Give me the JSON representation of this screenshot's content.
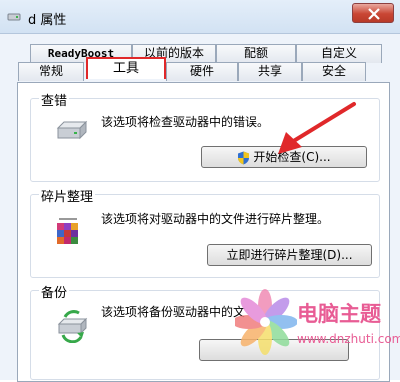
{
  "window": {
    "title": "d 属性"
  },
  "tabs_row1": [
    "ReadyBoost",
    "以前的版本",
    "配额",
    "自定义"
  ],
  "tabs_row2": [
    "常规",
    "工具",
    "硬件",
    "共享",
    "安全"
  ],
  "active_tab": "工具",
  "groups": [
    {
      "title": "查错",
      "desc": "该选项将检查驱动器中的错误。",
      "button": "开始检查(C)...",
      "icon": "hard-drive-icon"
    },
    {
      "title": "碎片整理",
      "desc": "该选项将对驱动器中的文件进行碎片整理。",
      "button": "立即进行碎片整理(D)...",
      "icon": "defrag-icon"
    },
    {
      "title": "备份",
      "desc": "该选项将备份驱动器中的文",
      "icon": "backup-icon"
    }
  ],
  "watermark": {
    "text": "电脑主题",
    "url": "www.dnzhuti.com"
  },
  "colors": {
    "highlight": "#e0282a",
    "watermark": "#e85c94",
    "title_bar": "#d2e2f3"
  }
}
